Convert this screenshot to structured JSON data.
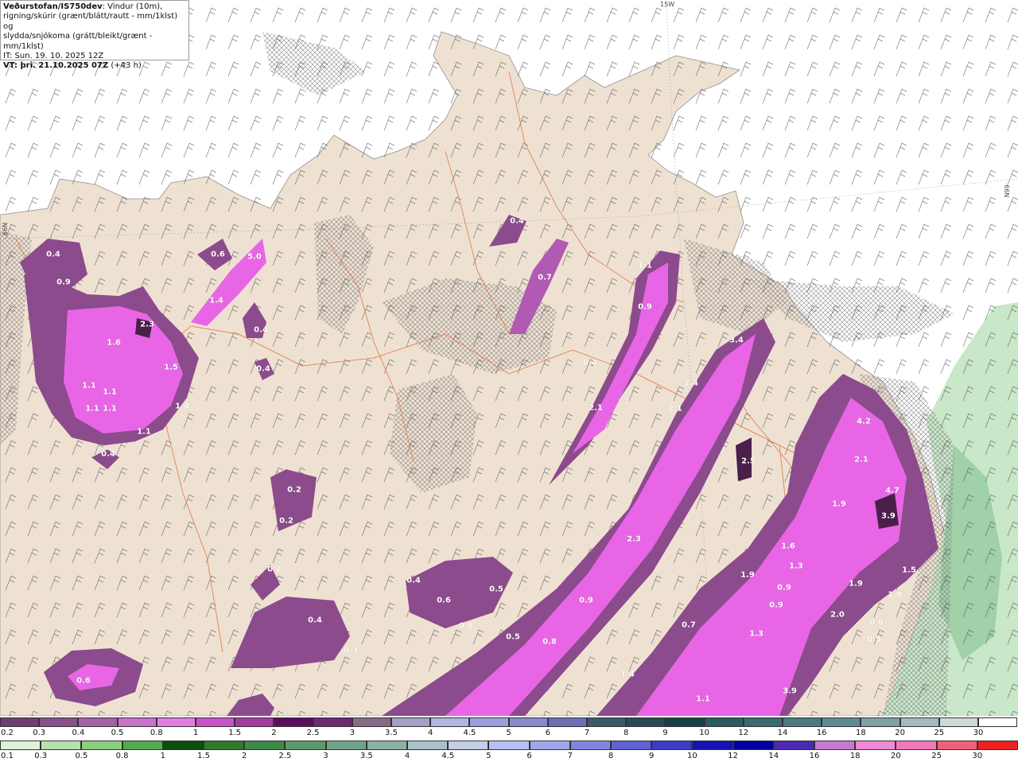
{
  "header": {
    "source": "Veðurstofan/IS750dev",
    "line1_rest": ": Vindur (10m),",
    "line2": "rigning/skúrir (grænt/blátt/rautt - mm/1klst) og",
    "line3": "slydda/snjókoma (grátt/bleikt/grænt - mm/1klst)",
    "it_line": "IT: Sun. 19. 10. 2025 12Z",
    "vt_label": "VT: þri. 21.10.2025 07Z",
    "vt_offset": " (+43 h)"
  },
  "grid_labels": {
    "lon_15w": "15W",
    "lat_66n_left": "66N",
    "lat_66n_right": "66N"
  },
  "colors": {
    "sea": "#ffffff",
    "land": "#efe1d2",
    "hatch": "#7a7a7a",
    "roads": "#e07a4e",
    "precip_light": "#8c4b8c",
    "precip_mid": "#b05ab3",
    "precip_high": "#e866e6",
    "precip_dark": "#4a1f4a",
    "rain_green": "#bfe3bf"
  },
  "map_values": [
    {
      "text": "0.4"
    },
    {
      "text": "0.9"
    },
    {
      "text": "2.3"
    },
    {
      "text": "1.6"
    },
    {
      "text": "1.5"
    },
    {
      "text": "1.1"
    },
    {
      "text": "1.1"
    },
    {
      "text": "1.1"
    },
    {
      "text": "1.1"
    },
    {
      "text": "1.4"
    },
    {
      "text": "1.1"
    },
    {
      "text": "0.4"
    },
    {
      "text": "0.6"
    },
    {
      "text": "5.0"
    },
    {
      "text": "1.4"
    },
    {
      "text": "0.4"
    },
    {
      "text": "0.4"
    },
    {
      "text": "0.4"
    },
    {
      "text": "0.7"
    },
    {
      "text": "1.1"
    },
    {
      "text": "0.9"
    },
    {
      "text": "0.4"
    },
    {
      "text": "2.1"
    },
    {
      "text": "3.4"
    },
    {
      "text": "2.4"
    },
    {
      "text": "2.1"
    },
    {
      "text": "2.5"
    },
    {
      "text": "4.2"
    },
    {
      "text": "2.1"
    },
    {
      "text": "4.7"
    },
    {
      "text": "3.9"
    },
    {
      "text": "1.9"
    },
    {
      "text": "1.6"
    },
    {
      "text": "1.3"
    },
    {
      "text": "0.9"
    },
    {
      "text": "0.9"
    },
    {
      "text": "1.5"
    },
    {
      "text": "1.9"
    },
    {
      "text": "1.9"
    },
    {
      "text": "2.0"
    },
    {
      "text": "0.8"
    },
    {
      "text": "0.5"
    },
    {
      "text": "2.3"
    },
    {
      "text": "0.2"
    },
    {
      "text": "0.2"
    },
    {
      "text": "0.2"
    },
    {
      "text": "0.4"
    },
    {
      "text": "0.6"
    },
    {
      "text": "0.5"
    },
    {
      "text": "0.4"
    },
    {
      "text": "0.3"
    },
    {
      "text": "0.6"
    },
    {
      "text": "0.5"
    },
    {
      "text": "0.8"
    },
    {
      "text": "0.9"
    },
    {
      "text": "0.7"
    },
    {
      "text": "1.9"
    },
    {
      "text": "1.3"
    },
    {
      "text": "1.4"
    },
    {
      "text": "1.1"
    },
    {
      "text": "3.9"
    },
    {
      "text": "0.6"
    }
  ],
  "legend_snow": {
    "ticks": [
      "0.2",
      "0.3",
      "0.4",
      "0.5",
      "0.8",
      "1",
      "1.5",
      "2",
      "2.5",
      "3",
      "3.5",
      "4",
      "4.5",
      "5",
      "6",
      "7",
      "8",
      "9",
      "10",
      "12",
      "14",
      "16",
      "18",
      "20",
      "25",
      "30"
    ],
    "colors": [
      "#6e3e6e",
      "#8a4f8a",
      "#a560a6",
      "#c872c9",
      "#e27ee3",
      "#c853c8",
      "#a33ba3",
      "#5c0d5c",
      "#6d2a6d",
      "#866a86",
      "#a6a0c6",
      "#b4b4e6",
      "#9e9ede",
      "#8a8ad0",
      "#6f6fb5",
      "#3e5a6a",
      "#2a4b55",
      "#174046",
      "#2c5a62",
      "#3c6a72",
      "#4a7a80",
      "#5e8c92",
      "#7ea2a6",
      "#a5babc",
      "#d0d8d8",
      "#ffffff"
    ]
  },
  "legend_rain": {
    "ticks": [
      "0.1",
      "0.3",
      "0.5",
      "0.8",
      "1",
      "1.5",
      "2",
      "2.5",
      "3",
      "3.5",
      "4",
      "4.5",
      "5",
      "6",
      "7",
      "8",
      "9",
      "10",
      "12",
      "14",
      "16",
      "18",
      "20",
      "25",
      "30"
    ],
    "colors": [
      "#dff2d6",
      "#b9e1ad",
      "#8ccf80",
      "#55a94e",
      "#0a4f0a",
      "#2f7a2f",
      "#3e8a4a",
      "#5a9a6a",
      "#70a48a",
      "#8ab2a8",
      "#a9c3c9",
      "#c5d0e6",
      "#b9c0ef",
      "#9fa6ea",
      "#7f86e0",
      "#5e62d6",
      "#3c3cc8",
      "#1414b4",
      "#0000a0",
      "#4a2ab5",
      "#c47ad4",
      "#ef8bd6",
      "#f07ab9",
      "#f0607a",
      "#ee2020"
    ]
  }
}
